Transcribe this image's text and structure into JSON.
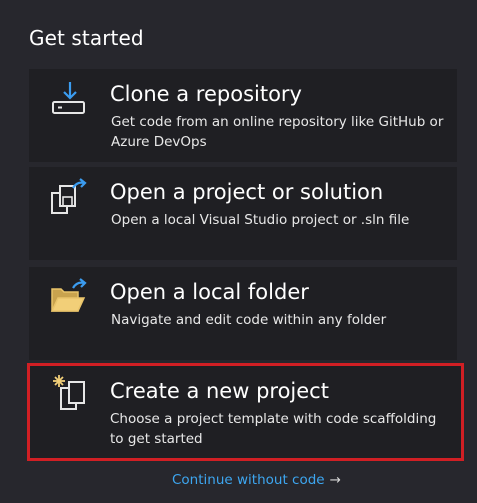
{
  "section": {
    "title": "Get started"
  },
  "cards": [
    {
      "title": "Clone a repository",
      "description": "Get code from an online repository like GitHub or Azure DevOps",
      "icon": "clone-repository-icon"
    },
    {
      "title": "Open a project or solution",
      "description": "Open a local Visual Studio project or .sln file",
      "icon": "open-project-icon"
    },
    {
      "title": "Open a local folder",
      "description": "Navigate and edit code within any folder",
      "icon": "open-folder-icon"
    },
    {
      "title": "Create a new project",
      "description": "Choose a project template with code scaffolding to get started",
      "icon": "new-project-icon"
    }
  ],
  "continue_link": {
    "label": "Continue without code",
    "arrow": "→"
  },
  "colors": {
    "background": "#27272d",
    "card": "#1f1f23",
    "highlight_border": "#d11f24",
    "link": "#3da6f0",
    "icon_accent": "#3b9cf0",
    "folder": "#e9c46a"
  }
}
